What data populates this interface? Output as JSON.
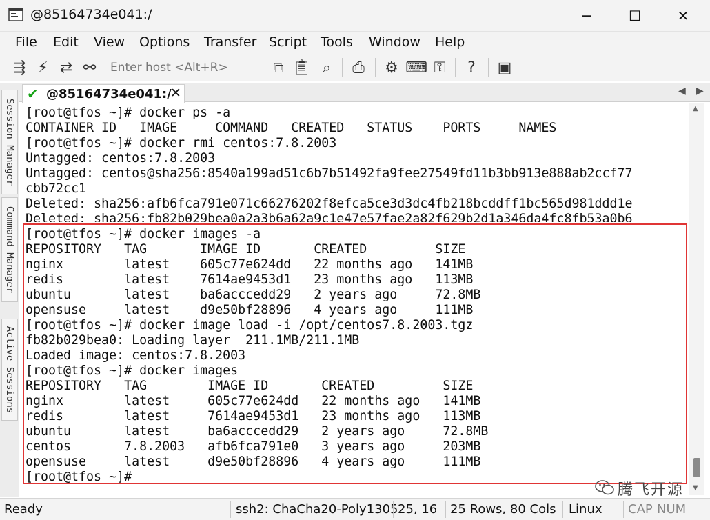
{
  "window": {
    "title": "@85164734e041:/",
    "controls": {
      "minimize": "─",
      "maximize": "☐",
      "close": "✕"
    }
  },
  "menu": [
    "File",
    "Edit",
    "View",
    "Options",
    "Transfer",
    "Script",
    "Tools",
    "Window",
    "Help"
  ],
  "toolbar": {
    "host_placeholder": "Enter host <Alt+R>",
    "icons": [
      "connect-icon",
      "quick-connect-icon",
      "reconnect-icon",
      "disconnect-icon",
      "copy-icon",
      "paste-icon",
      "find-icon",
      "print-icon",
      "settings-icon",
      "keymap-icon",
      "key-icon",
      "help-icon",
      "sftp-icon"
    ]
  },
  "side_tabs": [
    "Session Manager",
    "Command Manager",
    "Active Sessions"
  ],
  "session_tab": {
    "label": "@85164734e041:/",
    "close": "✕"
  },
  "terminal_lines": [
    "[root@tfos ~]# docker ps -a",
    "CONTAINER ID   IMAGE     COMMAND   CREATED   STATUS    PORTS     NAMES",
    "[root@tfos ~]# docker rmi centos:7.8.2003",
    "Untagged: centos:7.8.2003",
    "Untagged: centos@sha256:8540a199ad51c6b7b51492fa9fee27549fd11b3bb913e888ab2ccf77",
    "cbb72cc1",
    "Deleted: sha256:afb6fca791e071c66276202f8efca5ce3d3dc4fb218bcddff1bc565d981ddd1e",
    "Deleted: sha256:fb82b029bea0a2a3b6a62a9c1e47e57fae2a82f629b2d1a346da4fc8fb53a0b6",
    "[root@tfos ~]# docker images -a",
    "REPOSITORY   TAG       IMAGE ID       CREATED         SIZE",
    "nginx        latest    605c77e624dd   22 months ago   141MB",
    "redis        latest    7614ae9453d1   23 months ago   113MB",
    "ubuntu       latest    ba6acccedd29   2 years ago     72.8MB",
    "opensuse     latest    d9e50bf28896   4 years ago     111MB",
    "[root@tfos ~]# docker image load -i /opt/centos7.8.2003.tgz",
    "fb82b029bea0: Loading layer  211.1MB/211.1MB",
    "Loaded image: centos:7.8.2003",
    "[root@tfos ~]# docker images",
    "REPOSITORY   TAG        IMAGE ID       CREATED         SIZE",
    "nginx        latest     605c77e624dd   22 months ago   141MB",
    "redis        latest     7614ae9453d1   23 months ago   113MB",
    "ubuntu       latest     ba6acccedd29   2 years ago     72.8MB",
    "centos       7.8.2003   afb6fca791e0   3 years ago     203MB",
    "opensuse     latest     d9e50bf28896   4 years ago     111MB",
    "[root@tfos ~]#"
  ],
  "watermark": "腾飞开源",
  "status": {
    "ready": "Ready",
    "cipher": "ssh2: ChaCha20-Poly1305",
    "cursor": "25,  16",
    "size": "25 Rows, 80 Cols",
    "os": "Linux",
    "caps": "CAP",
    "num": "NUM"
  },
  "colors": {
    "highlight": "#e03535",
    "check": "#18a318"
  }
}
